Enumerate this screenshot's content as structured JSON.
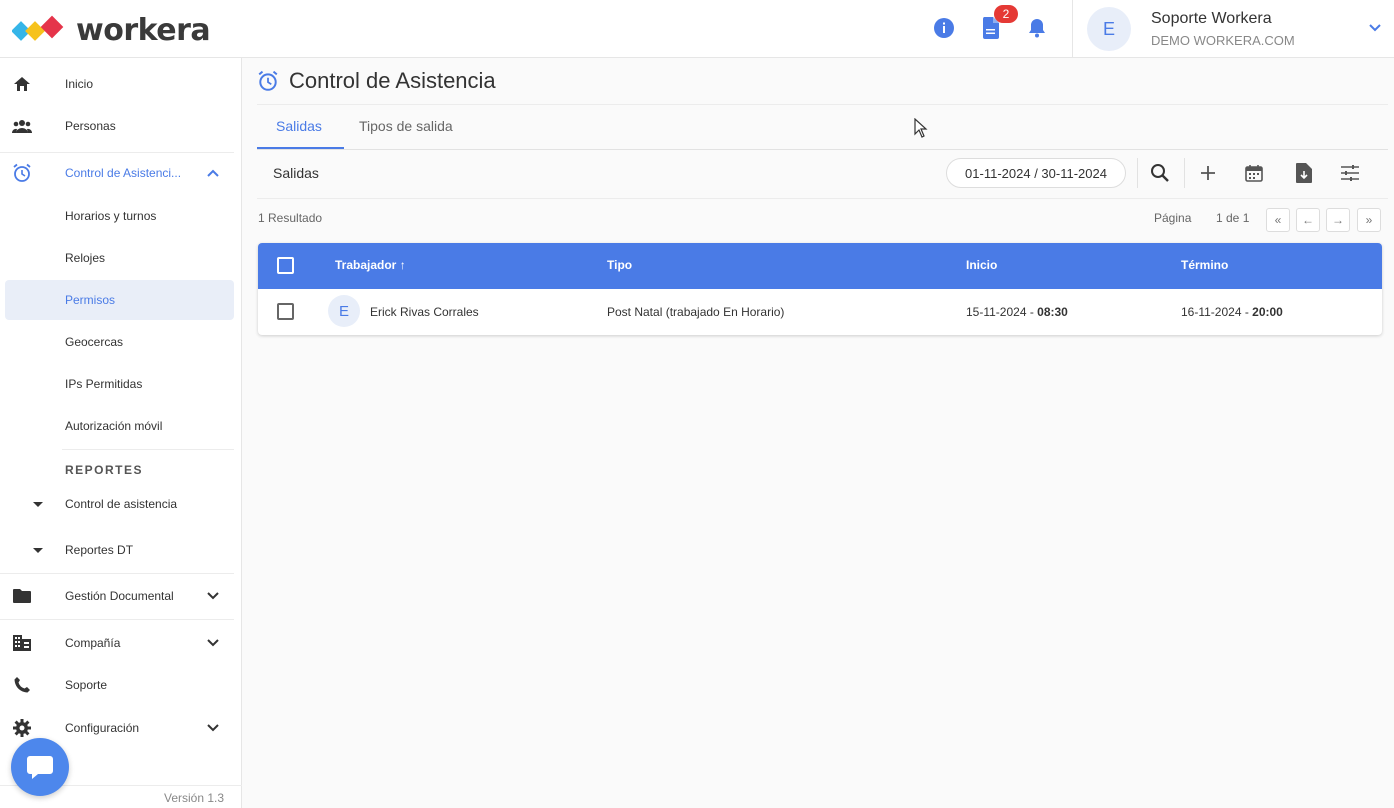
{
  "app": {
    "logo_text": "workera"
  },
  "header": {
    "notification_count": "2",
    "user_initial": "E",
    "user_name": "Soporte Workera",
    "user_org": "DEMO WORKERA.COM"
  },
  "sidebar": {
    "items": [
      {
        "label": "Inicio"
      },
      {
        "label": "Personas"
      },
      {
        "label": "Control de Asistenci..."
      },
      {
        "label": "Horarios y turnos"
      },
      {
        "label": "Relojes"
      },
      {
        "label": "Permisos"
      },
      {
        "label": "Geocercas"
      },
      {
        "label": "IPs Permitidas"
      },
      {
        "label": "Autorización móvil"
      }
    ],
    "reports_title": "REPORTES",
    "reports": [
      {
        "label": "Control de asistencia"
      },
      {
        "label": "Reportes DT"
      }
    ],
    "bottom": [
      {
        "label": "Gestión Documental"
      },
      {
        "label": "Compañía"
      },
      {
        "label": "Soporte"
      },
      {
        "label": "Configuración"
      }
    ],
    "version": "Versión 1.3"
  },
  "page": {
    "title": "Control de Asistencia",
    "tabs": [
      {
        "label": "Salidas"
      },
      {
        "label": "Tipos de salida"
      }
    ],
    "toolbar_title": "Salidas",
    "date_range": "01-11-2024 / 30-11-2024",
    "results": "1 Resultado",
    "pagination": {
      "label": "Página",
      "value": "1 de 1",
      "first": "«",
      "prev": "←",
      "next": "→",
      "last": "»"
    }
  },
  "table": {
    "headers": {
      "worker": "Trabajador",
      "sort_arrow": "↑",
      "type": "Tipo",
      "start": "Inicio",
      "end": "Término"
    },
    "rows": [
      {
        "initial": "E",
        "worker": "Erick Rivas Corrales",
        "type": "Post Natal (trabajado En Horario)",
        "start_date": "15-11-2024 - ",
        "start_time": "08:30",
        "end_date": "16-11-2024 - ",
        "end_time": "20:00"
      }
    ]
  },
  "colors": {
    "accent": "#4a7be6",
    "badge": "#e53935",
    "chat": "#4d87ec"
  }
}
